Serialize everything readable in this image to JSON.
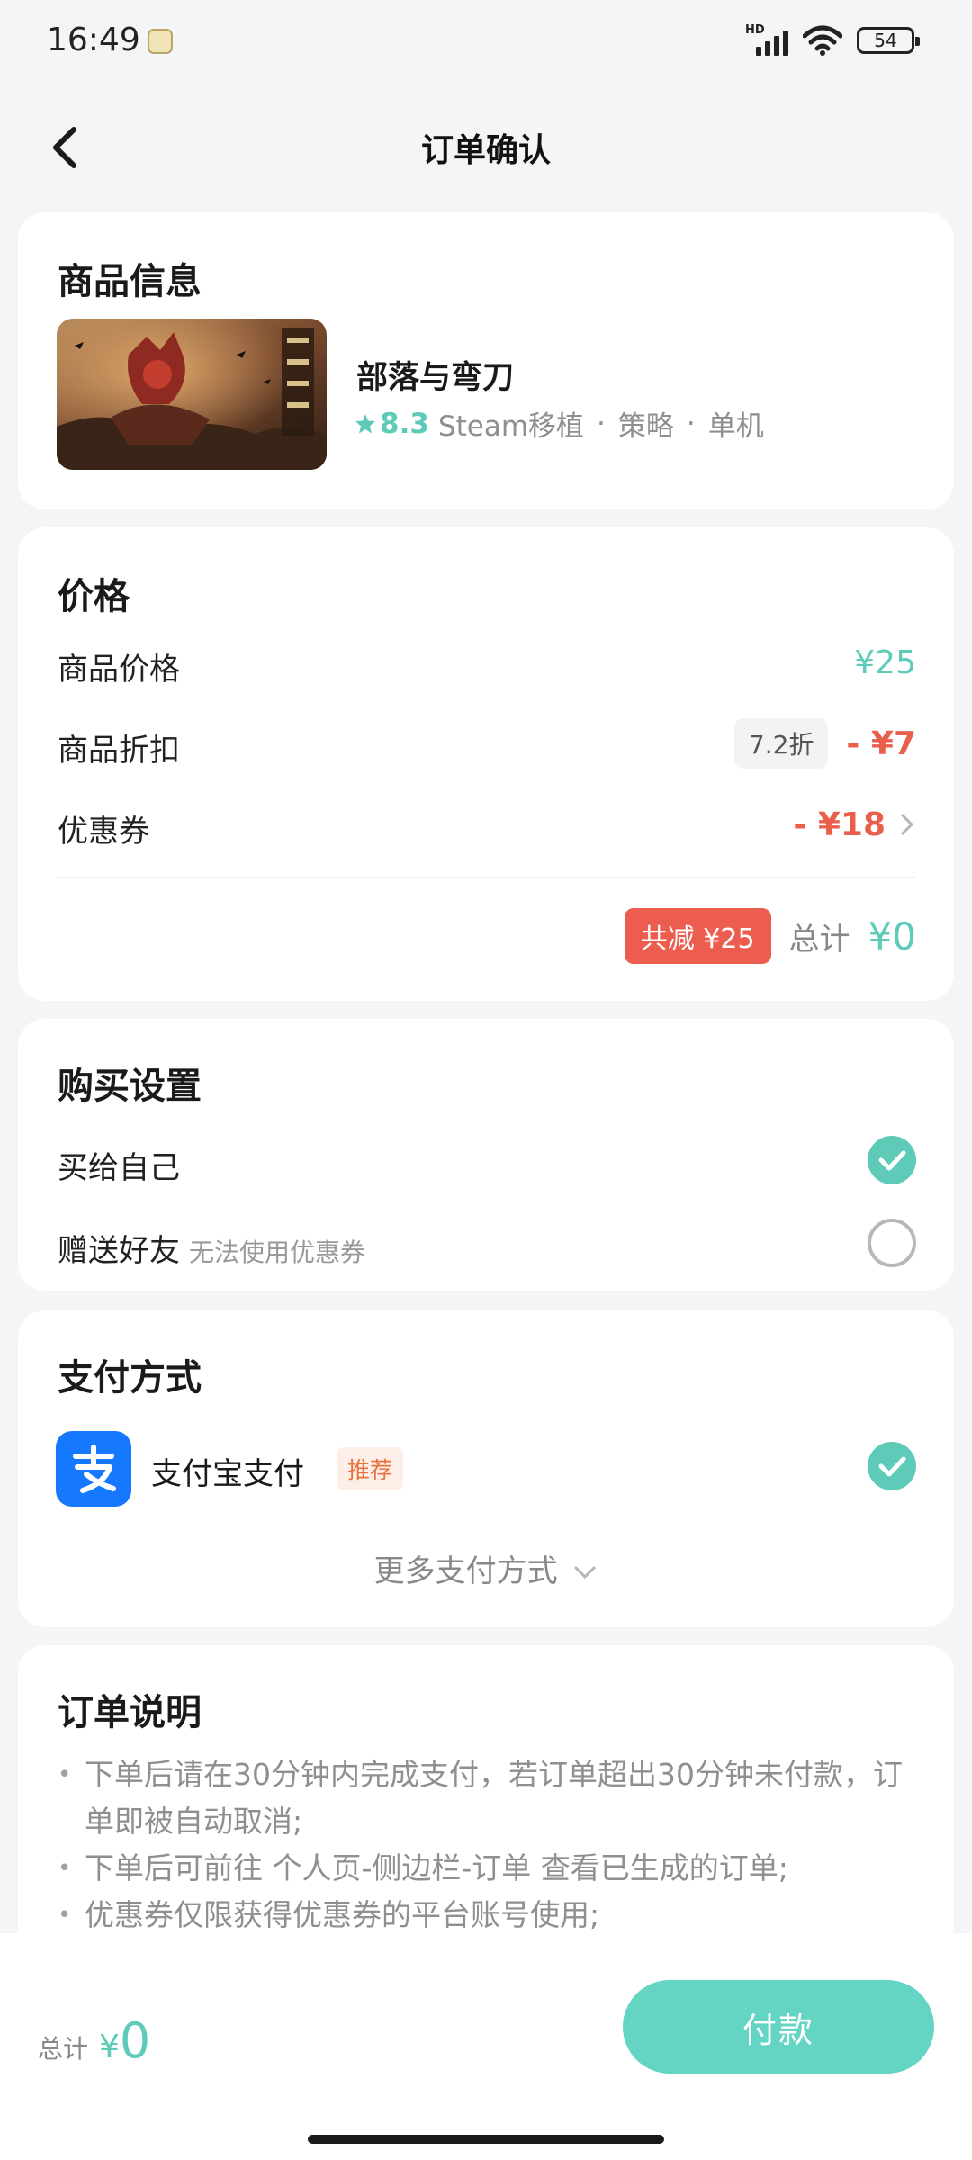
{
  "status_bar": {
    "time": "16:49",
    "network": "HD",
    "battery": "54"
  },
  "header": {
    "title": "订单确认"
  },
  "product": {
    "section_title": "商品信息",
    "name": "部落与弯刀",
    "rating": "8.3",
    "tags": [
      "Steam移植",
      "策略",
      "单机"
    ]
  },
  "price": {
    "section_title": "价格",
    "item_price_label": "商品价格",
    "item_price_value": "¥25",
    "discount_label": "商品折扣",
    "discount_badge": "7.2折",
    "discount_value": "- ¥7",
    "coupon_label": "优惠券",
    "coupon_value": "- ¥18",
    "saving_badge": "共减 ¥25",
    "total_label": "总计",
    "total_value": "¥0"
  },
  "purchase": {
    "section_title": "购买设置",
    "options": [
      {
        "label": "买给自己",
        "sub": "",
        "selected": true
      },
      {
        "label": "赠送好友",
        "sub": "无法使用优惠券",
        "selected": false
      }
    ]
  },
  "payment": {
    "section_title": "支付方式",
    "method": "支付宝支付",
    "badge": "推荐",
    "selected": true,
    "more_label": "更多支付方式"
  },
  "notes": {
    "section_title": "订单说明",
    "items": [
      "下单后请在30分钟内完成支付，若订单超出30分钟未付款，订单即被自动取消;",
      "下单后可前往 个人页-侧边栏-订单 查看已生成的订单;",
      "优惠券仅限获得优惠券的平台账号使用;"
    ]
  },
  "bottom_bar": {
    "total_label": "总计",
    "currency": "¥",
    "total_value": "0",
    "pay_button": "付款"
  },
  "colors": {
    "accent": "#5dcbb8",
    "discount": "#e8604c",
    "pay_button": "#64d5c3",
    "alipay": "#1677ff"
  }
}
